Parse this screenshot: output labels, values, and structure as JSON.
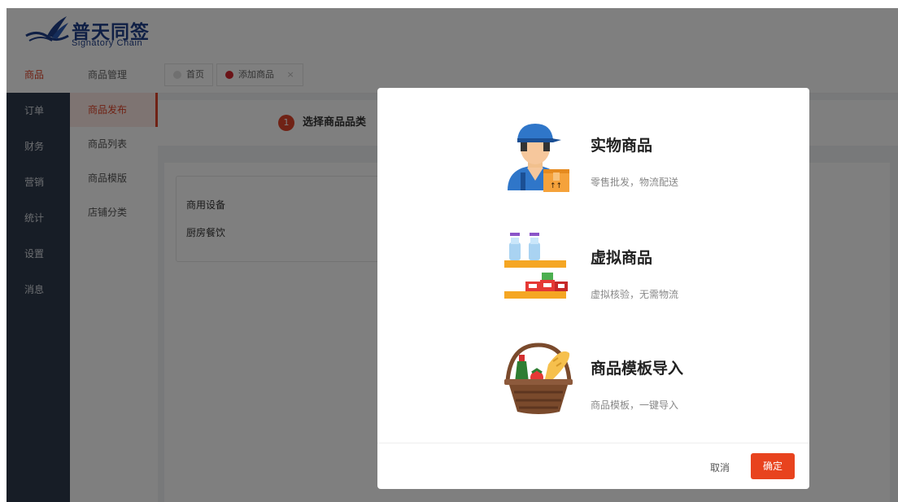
{
  "brand": {
    "name": "普天同签",
    "tagline": "Signatory Chain"
  },
  "rail": {
    "items": [
      "商品",
      "订单",
      "财务",
      "营销",
      "统计",
      "设置",
      "消息"
    ],
    "active_index": 0
  },
  "subnav": {
    "header": "商品管理",
    "items": [
      "商品发布",
      "商品列表",
      "商品模版",
      "店铺分类"
    ],
    "active_index": 0
  },
  "tabs": [
    {
      "label": "首页",
      "closable": false
    },
    {
      "label": "添加商品",
      "closable": true,
      "close_glyph": "×"
    }
  ],
  "steps": {
    "number": "1",
    "label": "选择商品品类"
  },
  "categories": [
    "商用设备",
    "厨房餐饮"
  ],
  "modal": {
    "options": [
      {
        "title": "实物商品",
        "desc": "零售批发，物流配送",
        "icon": "delivery-worker-icon"
      },
      {
        "title": "虚拟商品",
        "desc": "虚拟核验，无需物流",
        "icon": "shelf-goods-icon"
      },
      {
        "title": "商品模板导入",
        "desc": "商品模板，一键导入",
        "icon": "grocery-basket-icon"
      }
    ],
    "cancel_label": "取消",
    "ok_label": "确定"
  },
  "colors": {
    "accent": "#e8431e",
    "rail_bg": "#2f3b4c",
    "brand_blue": "#1f3f8a"
  }
}
